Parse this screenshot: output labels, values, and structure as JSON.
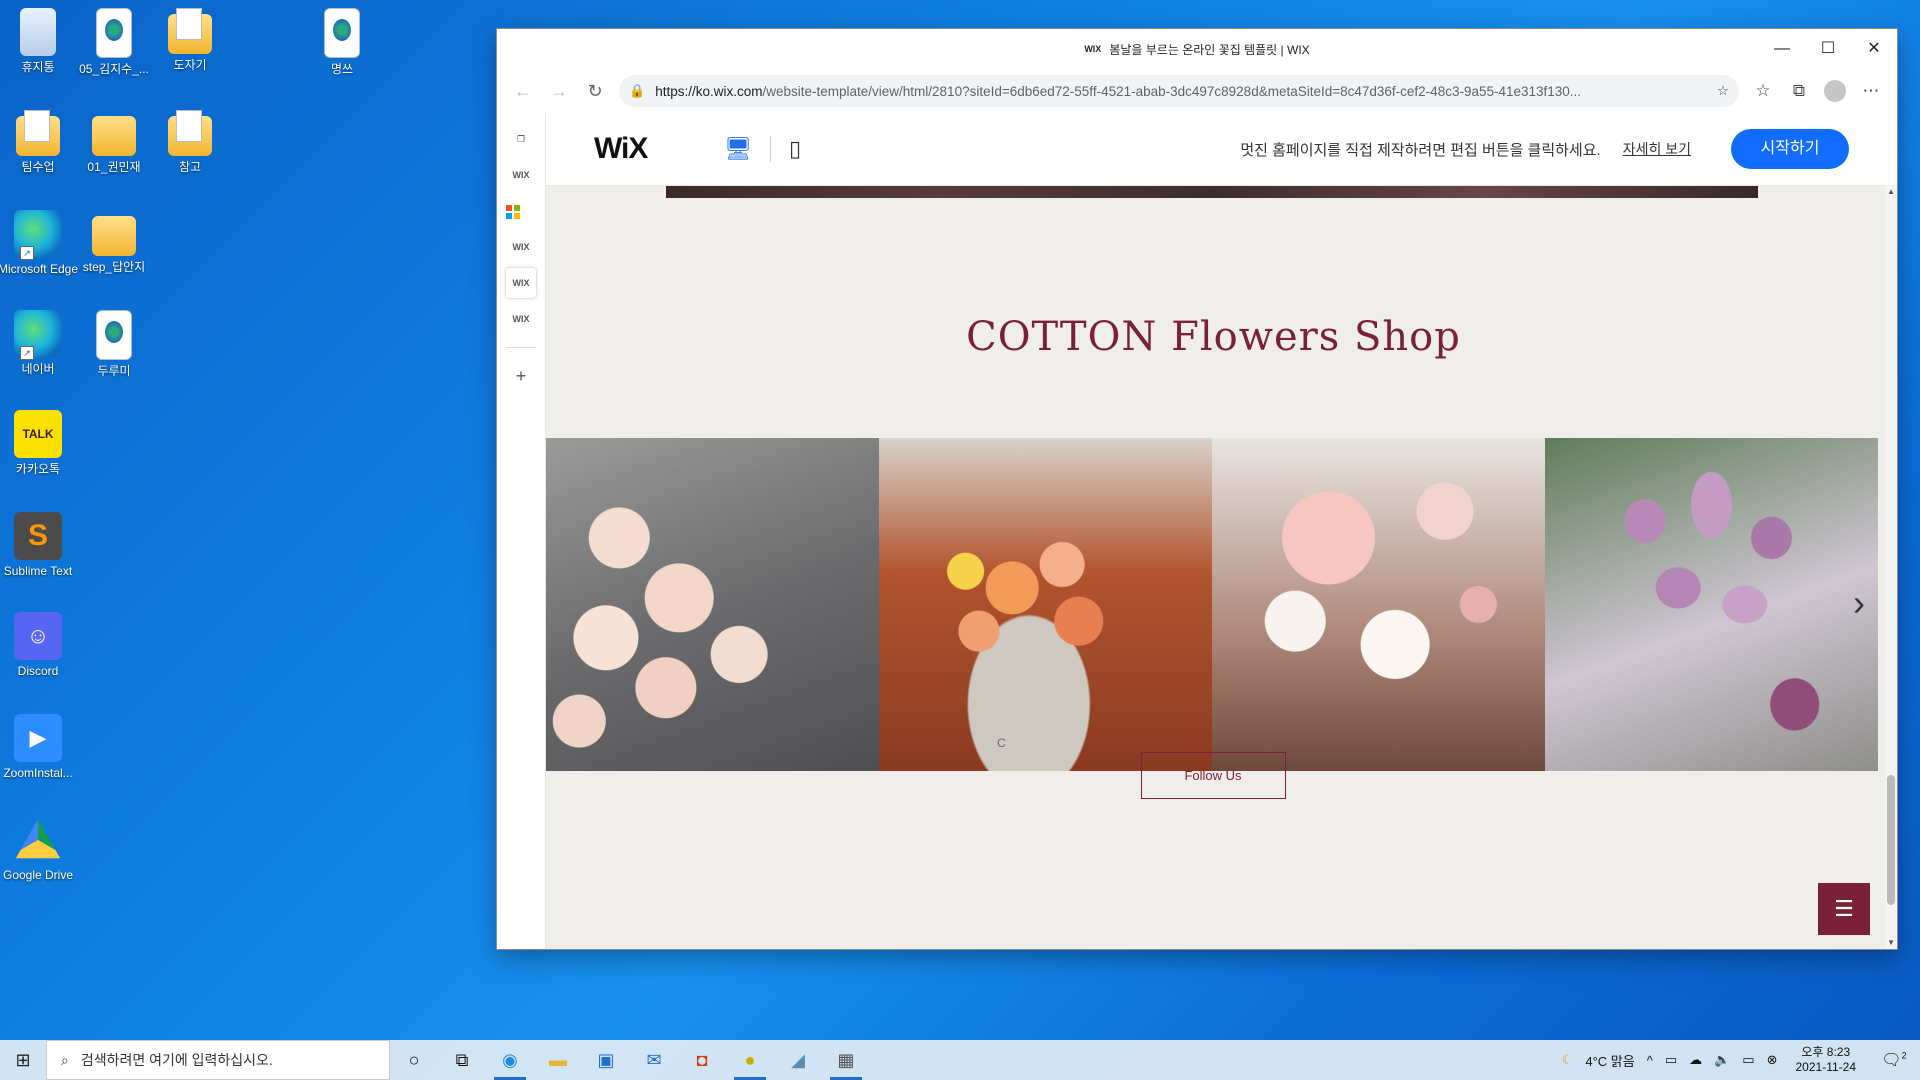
{
  "desktop": {
    "icons": [
      {
        "label": "휴지통"
      },
      {
        "label": "05_김지수_..."
      },
      {
        "label": "도자기"
      },
      {
        "label": "명쓰"
      },
      {
        "label": "팀수업"
      },
      {
        "label": "01_권민재"
      },
      {
        "label": "참고"
      },
      {
        "label": "Microsoft Edge"
      },
      {
        "label": "step_답안지"
      },
      {
        "label": "네이버"
      },
      {
        "label": "두루미"
      },
      {
        "label": "카카오톡"
      },
      {
        "label": "Sublime Text"
      },
      {
        "label": "Discord"
      },
      {
        "label": "ZoomInstal..."
      },
      {
        "label": "Google Drive"
      }
    ],
    "talk_badge": "TALK"
  },
  "browser": {
    "favicon_text": "WIX",
    "title": "봄날을 부르는 온라인 꽃집 템플릿 | WIX",
    "url_host": "https://ko.wix.com",
    "url_path": "/website-template/view/html/2810?siteId=6db6ed72-55ff-4521-abab-3dc497c8928d&metaSiteId=8c47d36f-cef2-48c3-9a55-41e313f130..."
  },
  "rail": {
    "items": [
      "WIX",
      "WIX",
      "WIX",
      "WIX"
    ]
  },
  "wix_bar": {
    "logo": "WiX",
    "message": "멋진 홈페이지를 직접 제작하려면 편집 버튼을 클릭하세요.",
    "details_link": "자세히 보기",
    "start_button": "시작하기"
  },
  "site": {
    "title": "COTTON Flowers Shop",
    "follow_button": "Follow Us",
    "pot_letter": "C"
  },
  "taskbar": {
    "search_placeholder": "검색하려면 여기에 입력하십시오.",
    "weather": "4°C  맑음",
    "time": "오후 8:23",
    "date": "2021-11-24",
    "notifications": "2"
  },
  "colors": {
    "accent_wix": "#116dff",
    "site_brand": "#7a2137",
    "site_bg": "#f0eeea"
  }
}
